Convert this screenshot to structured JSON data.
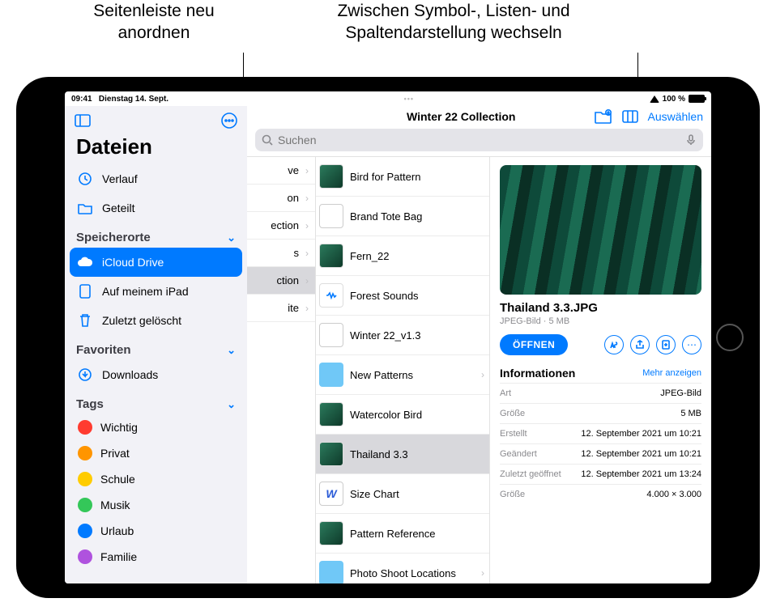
{
  "callouts": {
    "sidebar_reorder": "Seitenleiste neu anordnen",
    "view_switch": "Zwischen Symbol-, Listen- und Spaltendarstellung wechseln"
  },
  "status": {
    "time": "09:41",
    "date": "Dienstag 14. Sept.",
    "battery": "100 %"
  },
  "sidebar": {
    "title": "Dateien",
    "recents": "Verlauf",
    "shared": "Geteilt",
    "sections": {
      "locations": "Speicherorte",
      "favorites": "Favoriten",
      "tags": "Tags"
    },
    "locations": {
      "icloud": "iCloud Drive",
      "on_ipad": "Auf meinem iPad",
      "trash": "Zuletzt gelöscht"
    },
    "favorites": {
      "downloads": "Downloads"
    },
    "tags": [
      {
        "label": "Wichtig",
        "color": "#ff3b30"
      },
      {
        "label": "Privat",
        "color": "#ff9500"
      },
      {
        "label": "Schule",
        "color": "#ffcc00"
      },
      {
        "label": "Musik",
        "color": "#34c759"
      },
      {
        "label": "Urlaub",
        "color": "#007aff"
      },
      {
        "label": "Familie",
        "color": "#af52de"
      }
    ]
  },
  "toolbar": {
    "title": "Winter 22 Collection",
    "select": "Auswählen",
    "search_placeholder": "Suchen"
  },
  "col1": [
    {
      "label": "ve",
      "arrow": true
    },
    {
      "label": "on",
      "arrow": true
    },
    {
      "label": "ection",
      "arrow": true
    },
    {
      "label": "s",
      "arrow": true
    },
    {
      "label": "ction",
      "arrow": true,
      "selected": true
    },
    {
      "label": "ite",
      "arrow": true
    }
  ],
  "col2": [
    {
      "label": "Bird for Pattern",
      "kind": "img"
    },
    {
      "label": "Brand Tote Bag",
      "kind": "doc"
    },
    {
      "label": "Fern_22",
      "kind": "img"
    },
    {
      "label": "Forest Sounds",
      "kind": "audio"
    },
    {
      "label": "Winter 22_v1.3",
      "kind": "doc"
    },
    {
      "label": "New Patterns",
      "kind": "folder",
      "arrow": true
    },
    {
      "label": "Watercolor Bird",
      "kind": "img"
    },
    {
      "label": "Thailand 3.3",
      "kind": "img",
      "selected": true
    },
    {
      "label": "Size Chart",
      "kind": "w"
    },
    {
      "label": "Pattern Reference",
      "kind": "img"
    },
    {
      "label": "Photo Shoot Locations",
      "kind": "folder",
      "arrow": true
    }
  ],
  "detail": {
    "filename": "Thailand 3.3.JPG",
    "subtitle": "JPEG-Bild · 5 MB",
    "open": "ÖFFNEN",
    "info_title": "Informationen",
    "more": "Mehr anzeigen",
    "rows": [
      {
        "k": "Art",
        "v": "JPEG-Bild"
      },
      {
        "k": "Größe",
        "v": "5 MB"
      },
      {
        "k": "Erstellt",
        "v": "12. September 2021 um 10:21"
      },
      {
        "k": "Geändert",
        "v": "12. September 2021 um 10:21"
      },
      {
        "k": "Zuletzt geöffnet",
        "v": "12. September 2021 um 13:24"
      },
      {
        "k": "Größe",
        "v": "4.000 × 3.000"
      }
    ]
  }
}
